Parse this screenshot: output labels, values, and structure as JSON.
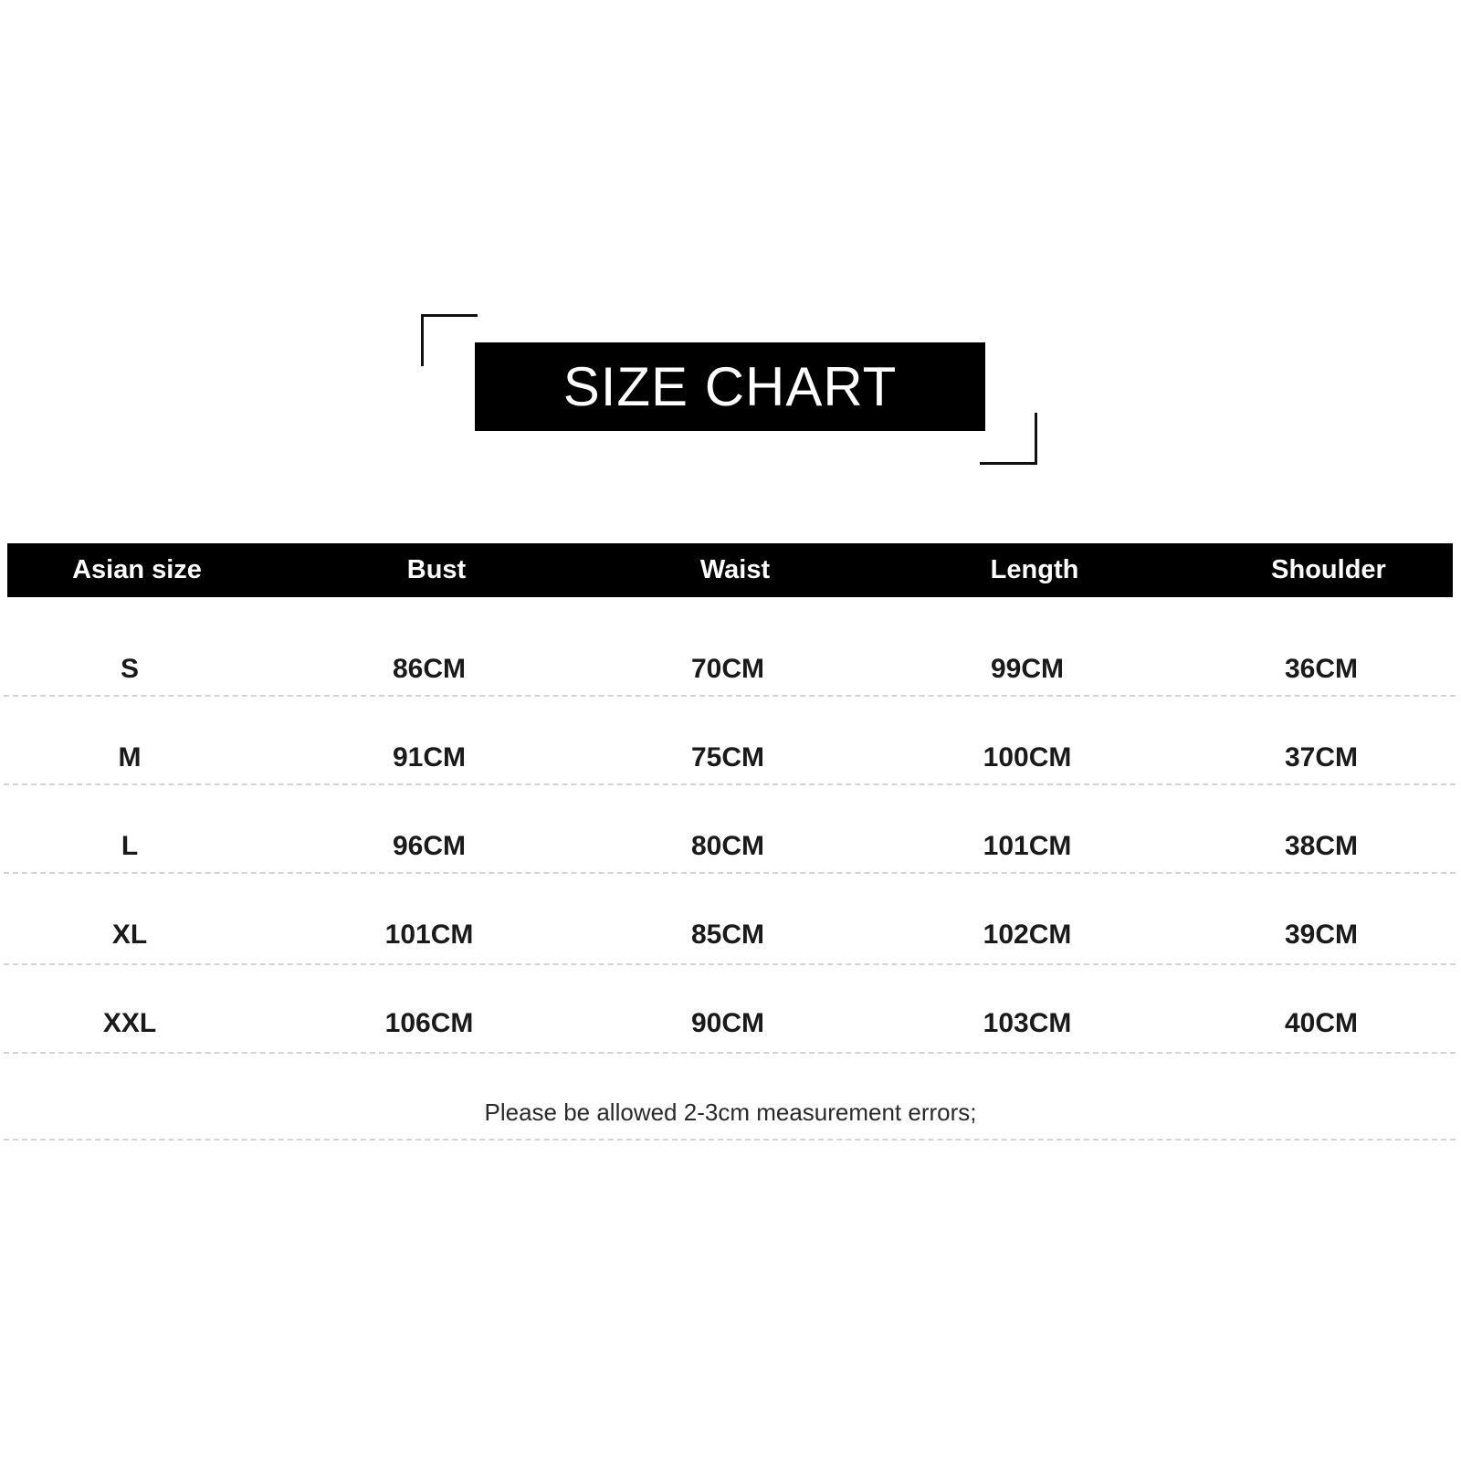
{
  "title": "SIZE CHART",
  "table": {
    "headers": [
      "Asian size",
      "Bust",
      "Waist",
      "Length",
      "Shoulder"
    ],
    "rows": [
      [
        "S",
        "86CM",
        "70CM",
        "99CM",
        "36CM"
      ],
      [
        "M",
        "91CM",
        "75CM",
        "100CM",
        "37CM"
      ],
      [
        "L",
        "96CM",
        "80CM",
        "101CM",
        "38CM"
      ],
      [
        "XL",
        "101CM",
        "85CM",
        "102CM",
        "39CM"
      ],
      [
        "XXL",
        "106CM",
        "90CM",
        "103CM",
        "40CM"
      ]
    ]
  },
  "note": "Please be allowed 2-3cm measurement errors;"
}
